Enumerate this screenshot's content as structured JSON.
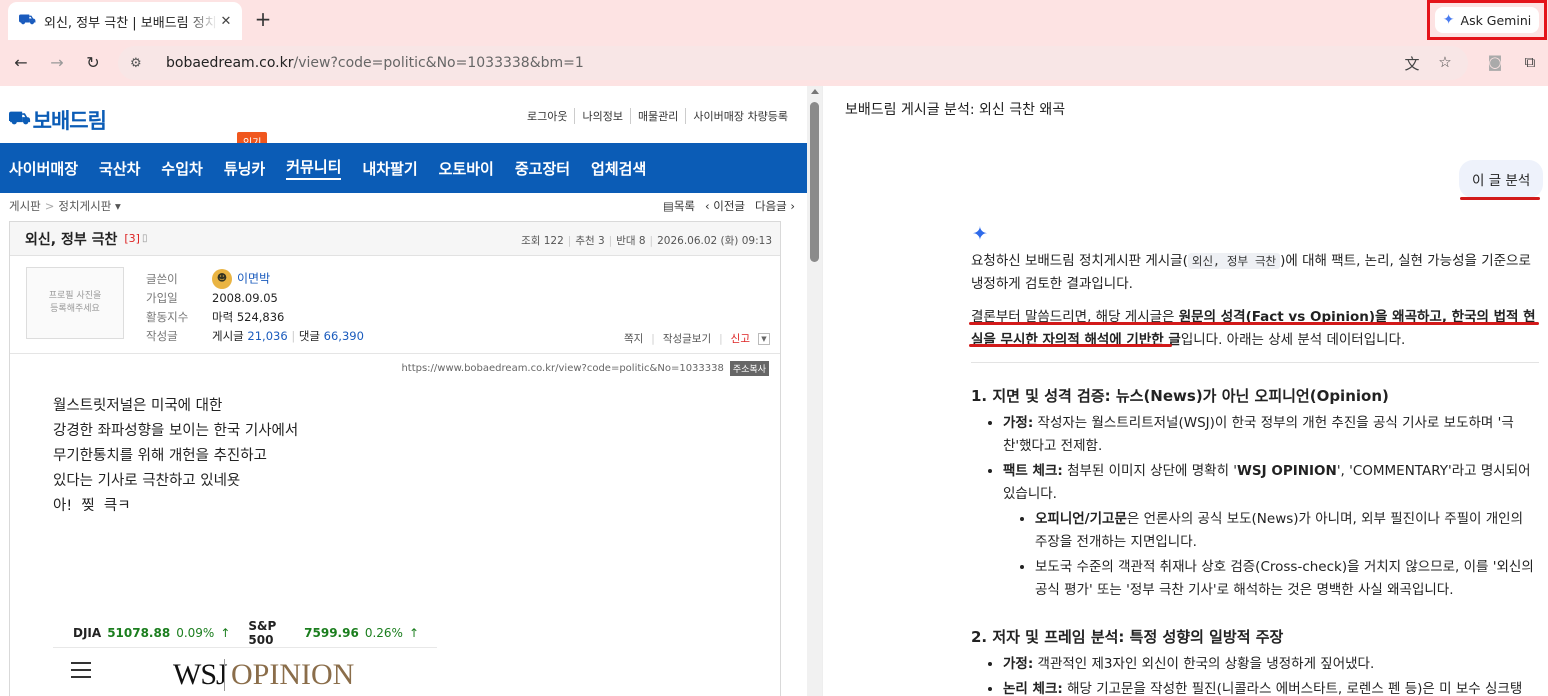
{
  "browser": {
    "tab_title": "외신, 정부 극찬 | 보배드림 정치",
    "url_host": "bobaedream.co.kr",
    "url_path": "/view?code=politic&No=1033338&bm=1",
    "gemini_button": "Ask Gemini"
  },
  "site": {
    "logo": "보배드림",
    "top_links": [
      "로그아웃",
      "나의정보",
      "매물관리",
      "사이버매장 차량등록"
    ],
    "hot_badge": "인기",
    "nav": [
      "사이버매장",
      "국산차",
      "수입차",
      "튜닝카",
      "커뮤니티",
      "내차팔기",
      "오토바이",
      "중고장터",
      "업체검색"
    ],
    "breadcrumb": [
      "게시판",
      "정치게시판 ▾"
    ],
    "list_links": [
      "▤목록",
      "‹ 이전글",
      "다음글 ›"
    ]
  },
  "post": {
    "title": "외신, 정부 극찬",
    "comment_count": "[3]",
    "stats": [
      "조회 122",
      "추천 3",
      "반대 8",
      "2026.06.02 (화) 09:13"
    ],
    "profile_placeholder": "프로필 사진을\n등록해주세요",
    "meta": {
      "author_label": "글쓴이",
      "author": "이면박",
      "joined_label": "가입일",
      "joined": "2008.09.05",
      "activity_label": "활동지수",
      "activity": "마력 524,836",
      "written_label": "작성글",
      "posts_label": "게시글",
      "posts": "21,036",
      "comments_label": "댓글",
      "comments": "66,390"
    },
    "actions": [
      "쪽지",
      "작성글보기",
      "신고"
    ],
    "url": "https://www.bobaedream.co.kr/view?code=politic&No=1033338",
    "copy_btn": "주소복사",
    "body_lines": [
      "월스트릿저널은 미국에 대한",
      "강경한 좌파성향을 보이는 한국 기사에서",
      "무기한통치를 위해 개헌을 추진하고",
      "있다는 기사로 극찬하고 있네욧",
      "아!  찢  큭ㅋ"
    ],
    "wsj": {
      "tickers": [
        {
          "sym": "DJIA",
          "val": "51078.88",
          "pct": "0.09%"
        },
        {
          "sym": "S&P 500",
          "val": "7599.96",
          "pct": "0.26%"
        }
      ],
      "logo": "WSJ",
      "section": "OPINION"
    }
  },
  "gemini": {
    "title": "보배드림 게시글 분석: 외신 극찬 왜곡",
    "user_msg": "이 글 분석",
    "intro_pre": "요청하신 보배드림 정치게시판 게시글(",
    "intro_code": "외신, 정부 극찬",
    "intro_post": ")에 대해 팩트, 논리, 실현 가능성을 기준으로 냉정하게 검토한 결과입니다.",
    "conclusion_pre": "결론부터 말씀드리면, 해당 게시글은 ",
    "conclusion_bold": "원문의 성격(Fact vs Opinion)을 왜곡하고, 한국의 법적 현실을 무시한 자의적 해석에 기반한 글",
    "conclusion_post": "입니다. 아래는 상세 분석 데이터입니다.",
    "s1_title": "1. 지면 및 성격 검증: 뉴스(News)가 아닌 오피니언(Opinion)",
    "s1_a_label": "가정:",
    "s1_a_text": " 작성자는 월스트리트저널(WSJ)이 한국 정부의 개헌 추진을 공식 기사로 보도하며 '극찬'했다고 전제함.",
    "s1_b_label": "팩트 체크:",
    "s1_b_pre": " 첨부된 이미지 상단에 명확히 '",
    "s1_b_bold1": "WSJ OPINION",
    "s1_b_mid": "', 'COMMENTARY'라고 명시되어 있습니다.",
    "s1_c_label": "오피니언/기고문",
    "s1_c_text": "은 언론사의 공식 보도(News)가 아니며, 외부 필진이나 주필이 개인의 주장을 전개하는 지면입니다.",
    "s1_d_text": "보도국 수준의 객관적 취재나 상호 검증(Cross-check)을 거치지 않으므로, 이를 '외신의 공식 평가' 또는 '정부 극찬 기사'로 해석하는 것은 명백한 사실 왜곡입니다.",
    "s2_title": "2. 저자 및 프레임 분석: 특정 성향의 일방적 주장",
    "s2_a_label": "가정:",
    "s2_a_text": " 객관적인 제3자인 외신이 한국의 상황을 냉정하게 짚어냈다.",
    "s2_b_label": "논리 체크:",
    "s2_b_text": " 해당 기고문을 작성한 필진(니콜라스 에버스타트, 로렌스 펜 등)은 미 보수 싱크탱"
  }
}
